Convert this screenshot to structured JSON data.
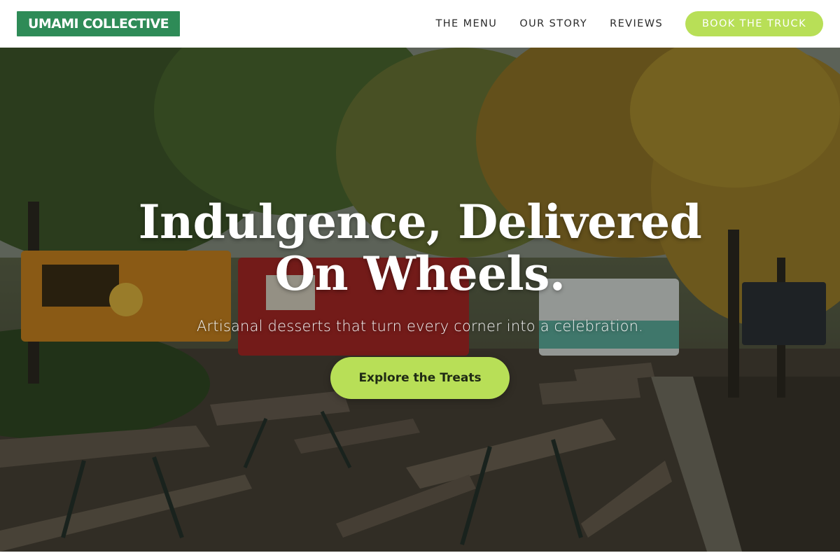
{
  "brand": {
    "logo_text": "UMAMI COLLECTIVE"
  },
  "nav": {
    "links": [
      "THE MENU",
      "OUR STORY",
      "REVIEWS"
    ],
    "cta_label": "BOOK THE TRUCK"
  },
  "hero": {
    "title": "Indulgence, Delivered On Wheels.",
    "subtitle": "Artisanal desserts that turn every corner into a celebration.",
    "button_label": "Explore the Treats",
    "background_icon": "food-truck-park-photo"
  },
  "colors": {
    "brand_green": "#2e8b57",
    "accent_lime": "#b8df57",
    "nav_text": "#2b2b2b",
    "hero_text": "#ffffff"
  }
}
